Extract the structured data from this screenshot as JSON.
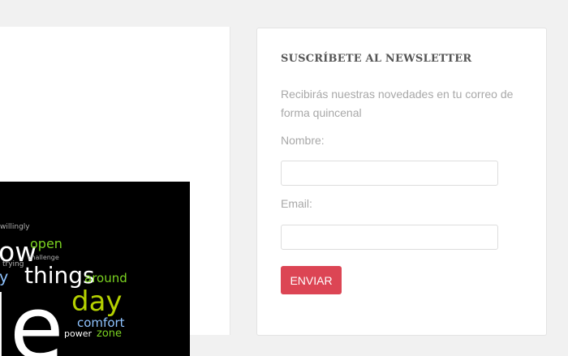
{
  "word_cloud": {
    "words": [
      {
        "text": "willingly",
        "color": "#b0b0b0"
      },
      {
        "text": "ow",
        "color": "#ffffff"
      },
      {
        "text": "open",
        "color": "#7bd321"
      },
      {
        "text": "challenge",
        "color": "#b0b0b0"
      },
      {
        "text": "trying",
        "color": "#b0b0b0"
      },
      {
        "text": "y",
        "color": "#8fc3ff"
      },
      {
        "text": "things",
        "color": "#ffffff"
      },
      {
        "text": "around",
        "color": "#7bd321"
      },
      {
        "text": "day",
        "color": "#b5d100"
      },
      {
        "text": "le",
        "color": "#ffffff"
      },
      {
        "text": "comfort",
        "color": "#8fc3ff"
      },
      {
        "text": "power",
        "color": "#ffffff"
      },
      {
        "text": "zone",
        "color": "#7bd321"
      }
    ]
  },
  "newsletter": {
    "title": "SUSCRÍBETE AL NEWSLETTER",
    "description": "Recibirás nuestras novedades en tu correo de forma quincenal",
    "name_label": "Nombre:",
    "name_value": "",
    "email_label": "Email:",
    "email_value": "",
    "submit_label": "ENVIAR",
    "button_color": "#dc4554"
  }
}
